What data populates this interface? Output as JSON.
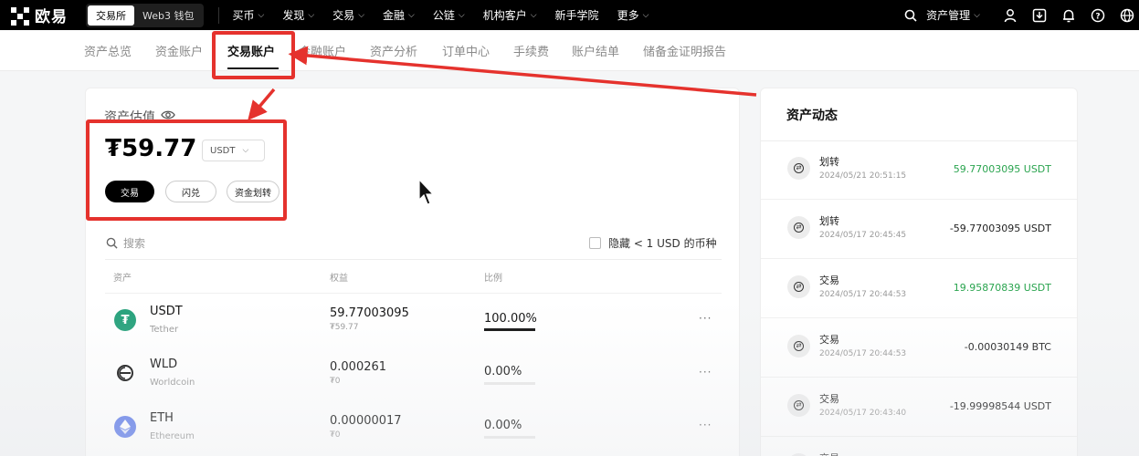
{
  "nav": {
    "logo_text": "欧易",
    "switch": [
      "交易所",
      "Web3 钱包"
    ],
    "menu": [
      "买币",
      "发现",
      "交易",
      "金融",
      "公链",
      "机构客户",
      "新手学院",
      "更多"
    ],
    "menu_has_chevron": [
      true,
      true,
      true,
      true,
      true,
      true,
      false,
      true
    ],
    "asset_mgmt": "资产管理"
  },
  "subnav": {
    "items": [
      "资产总览",
      "资金账户",
      "交易账户",
      "金融账户",
      "资产分析",
      "订单中心",
      "手续费",
      "账户结单",
      "储备金证明报告"
    ],
    "active_index": 2
  },
  "account": {
    "label": "资产估值",
    "balance": "₮59.77",
    "currency": "USDT",
    "buttons": {
      "trade": "交易",
      "flash": "闪兑",
      "transfer": "资金划转"
    }
  },
  "table": {
    "search_placeholder": "搜索",
    "hide_small": "隐藏 < 1 USD 的币种",
    "headers": [
      "资产",
      "权益",
      "比例"
    ],
    "rows": [
      {
        "symbol": "USDT",
        "name": "Tether",
        "equity": "59.77003095",
        "equity_sub": "₮59.77",
        "ratio": "100.00%",
        "ratio_value": 1.0,
        "icon": "tether-icon",
        "icon_color": "#26a17b"
      },
      {
        "symbol": "WLD",
        "name": "Worldcoin",
        "equity": "0.000261",
        "equity_sub": "₮0",
        "ratio": "0.00%",
        "ratio_value": 0.0,
        "icon": "worldcoin-icon",
        "icon_color": "#ffffff"
      },
      {
        "symbol": "ETH",
        "name": "Ethereum",
        "equity": "0.00000017",
        "equity_sub": "₮0",
        "ratio": "0.00%",
        "ratio_value": 0.0,
        "icon": "ethereum-icon",
        "icon_color": "#627eea"
      }
    ]
  },
  "activity": {
    "title": "资产动态",
    "items": [
      {
        "type": "划转",
        "time": "2024/05/21 20:51:15",
        "amount": "59.77003095 USDT",
        "positive": true
      },
      {
        "type": "划转",
        "time": "2024/05/17 20:45:45",
        "amount": "-59.77003095 USDT",
        "positive": false
      },
      {
        "type": "交易",
        "time": "2024/05/17 20:44:53",
        "amount": "19.95870839 USDT",
        "positive": true
      },
      {
        "type": "交易",
        "time": "2024/05/17 20:44:53",
        "amount": "-0.00030149 BTC",
        "positive": false
      },
      {
        "type": "交易",
        "time": "2024/05/17 20:43:40",
        "amount": "-19.99998544 USDT",
        "positive": false
      },
      {
        "type": "交易",
        "time": "",
        "amount": "",
        "positive": false
      }
    ]
  },
  "colors": {
    "positive": "#2aa44f",
    "annotation": "#e5322d",
    "brand": "#000000"
  }
}
